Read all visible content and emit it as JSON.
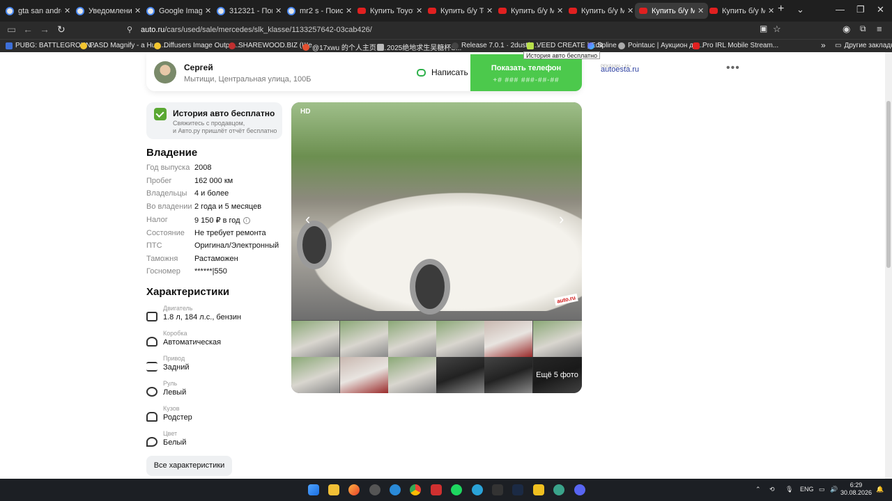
{
  "browser": {
    "tabs": [
      {
        "title": "gta san andreas"
      },
      {
        "title": "Уведомление о"
      },
      {
        "title": "Google Image Re"
      },
      {
        "title": "312321 - Поиск"
      },
      {
        "title": "mr2 s - Поиск в"
      },
      {
        "title": "Купить Toyota M"
      },
      {
        "title": "Купить б/у Toyot"
      },
      {
        "title": "Купить б/у Merc"
      },
      {
        "title": "Купить б/у Merc"
      },
      {
        "title": "Купить б/у Merc"
      },
      {
        "title": "Купить б/у Merc"
      }
    ],
    "url_domain": "auto.ru",
    "url_path": "/cars/used/sale/mercedes/slk_klasse/1133257642-03cab426/",
    "bookmarks": [
      "PUBG: BATTLEGROUN...",
      "PASD Magnify - a Hug...",
      "Diffusers Image Outpa...",
      "SHAREWOOD.BIZ (Ше...",
      "@17xwu 的个人主页 -...",
      "2025绝地求生吴糖杯S...",
      "Release 7.0.1 · 2dust/v...",
      "VEED CREATE | Edit",
      "Spline",
      "Pointauc | Аукцион дл...",
      "Pro IRL Mobile Stream...",
      "Другие закладки"
    ],
    "tooltip": "История авто бесплатно"
  },
  "seller": {
    "name": "Сергей",
    "address": "Мытищи, Центральная улица, 100Б",
    "write_label": "Написать",
    "phone_label": "Показать телефон",
    "phone_mask": "+# ### ###-##-##"
  },
  "ad": {
    "label": "РЕКЛАМА • 16+",
    "domain": "autoesta.ru"
  },
  "history": {
    "title": "История авто бесплатно",
    "line1": "Свяжитесь с продавцом,",
    "line2": "и Авто.ру пришлёт отчёт бесплатно"
  },
  "ownership": {
    "title": "Владение",
    "rows": [
      {
        "k": "Год выпуска",
        "v": "2008"
      },
      {
        "k": "Пробег",
        "v": "162 000 км"
      },
      {
        "k": "Владельцы",
        "v": "4 и более"
      },
      {
        "k": "Во владении",
        "v": "2 года и 5 месяцев"
      },
      {
        "k": "Налог",
        "v": "9 150 ₽ в год"
      },
      {
        "k": "Состояние",
        "v": "Не требует ремонта"
      },
      {
        "k": "ПТС",
        "v": "Оригинал/Электронный"
      },
      {
        "k": "Таможня",
        "v": "Растаможен"
      },
      {
        "k": "Госномер",
        "v": "******|550"
      }
    ]
  },
  "specs": {
    "title": "Характеристики",
    "rows": [
      {
        "k": "Двигатель",
        "v": "1.8 л, 184 л.с., бензин",
        "icon": "engine-icon"
      },
      {
        "k": "Коробка",
        "v": "Автоматическая",
        "icon": "gearbox-icon"
      },
      {
        "k": "Привод",
        "v": "Задний",
        "icon": "drive-icon"
      },
      {
        "k": "Руль",
        "v": "Левый",
        "icon": "steering-wheel-icon"
      },
      {
        "k": "Кузов",
        "v": "Родстер",
        "icon": "car-body-icon"
      },
      {
        "k": "Цвет",
        "v": "Белый",
        "icon": "color-icon"
      }
    ],
    "all_button": "Все характеристики"
  },
  "gallery": {
    "badge": "HD",
    "watermark": "auto.ru",
    "more_photos": "Ещё 5 фото"
  },
  "taskbar": {
    "lang": "ENG",
    "time": "6:29",
    "date": "30.08.2026"
  },
  "colors": {
    "accent": "#4cc94c",
    "tabbar": "#1f1f1f",
    "history_icon": "#5aa832"
  }
}
